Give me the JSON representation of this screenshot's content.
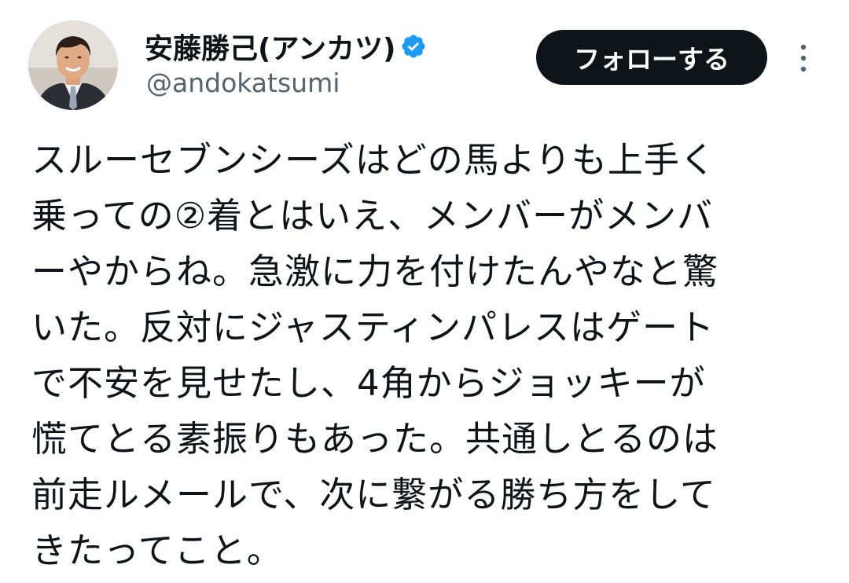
{
  "author": {
    "display_name": "安藤勝己(アンカツ)",
    "handle": "@andokatsumi",
    "verified": true,
    "avatar_icon": "profile-photo"
  },
  "actions": {
    "follow_label": "フォローする",
    "more_icon": "more-vertical-icon"
  },
  "tweet": {
    "lines": [
      "スルーセブンシーズはどの馬よりも上手く",
      "乗っての②着とはいえ、メンバーがメンバ",
      "ーやからね。急激に力を付けたんやなと驚",
      "いた。反対にジャスティンパレスはゲート",
      "で不安を見せたし、4角からジョッキーが",
      "慌てとる素振りもあった。共通しとるのは",
      "前走ルメールで、次に繋がる勝ち方をして",
      "きたってこと。"
    ]
  },
  "colors": {
    "text_primary": "#0f1419",
    "text_secondary": "#536471",
    "verified_blue": "#1d9bf0",
    "button_bg": "#0f1419",
    "button_text": "#ffffff",
    "background": "#ffffff"
  }
}
